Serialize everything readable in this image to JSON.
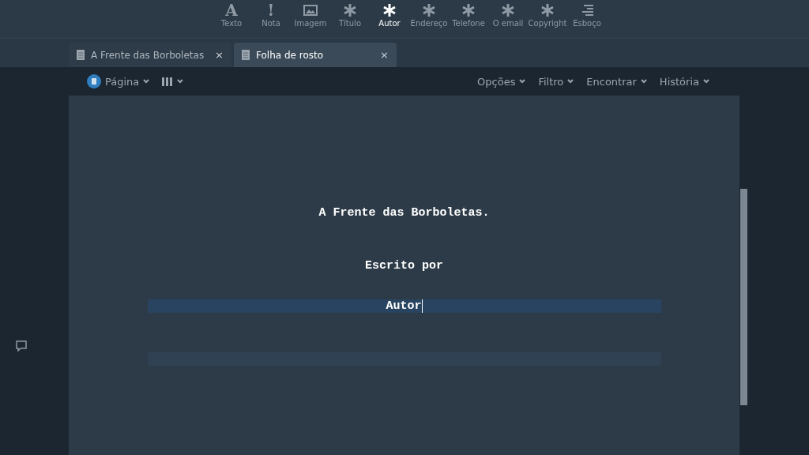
{
  "element_toolbar": [
    {
      "label": "Texto",
      "kind": "letter",
      "glyph": "A",
      "selected": false
    },
    {
      "label": "Nota",
      "kind": "note",
      "glyph": "!",
      "selected": false
    },
    {
      "label": "Imagem",
      "kind": "image",
      "selected": false
    },
    {
      "label": "Título",
      "kind": "asterisk",
      "selected": false
    },
    {
      "label": "Autor",
      "kind": "asterisk",
      "selected": true
    },
    {
      "label": "Endereço",
      "kind": "asterisk",
      "selected": false
    },
    {
      "label": "Telefone",
      "kind": "asterisk",
      "selected": false
    },
    {
      "label": "O email",
      "kind": "asterisk",
      "selected": false
    },
    {
      "label": "Copyright",
      "kind": "asterisk",
      "selected": false
    },
    {
      "label": "Esboço",
      "kind": "outline",
      "selected": false
    }
  ],
  "tabs": [
    {
      "label": "A Frente das Borboletas",
      "close": "×",
      "selected": false
    },
    {
      "label": "Folha de rosto",
      "close": "×",
      "selected": true
    }
  ],
  "view_bar": {
    "left": [
      {
        "label": "Página",
        "kind": "page"
      },
      {
        "kind": "columns"
      }
    ],
    "right": [
      {
        "label": "Opções"
      },
      {
        "label": "Filtro"
      },
      {
        "label": "Encontrar"
      },
      {
        "label": "História"
      }
    ]
  },
  "document": {
    "lines": [
      {
        "text": "A Frente das Borboletas.",
        "selected": false
      },
      {
        "text": "Escrito por",
        "selected": false
      },
      {
        "text": "Autor",
        "selected": true
      },
      {
        "kind": "empty",
        "comment": true
      }
    ]
  }
}
